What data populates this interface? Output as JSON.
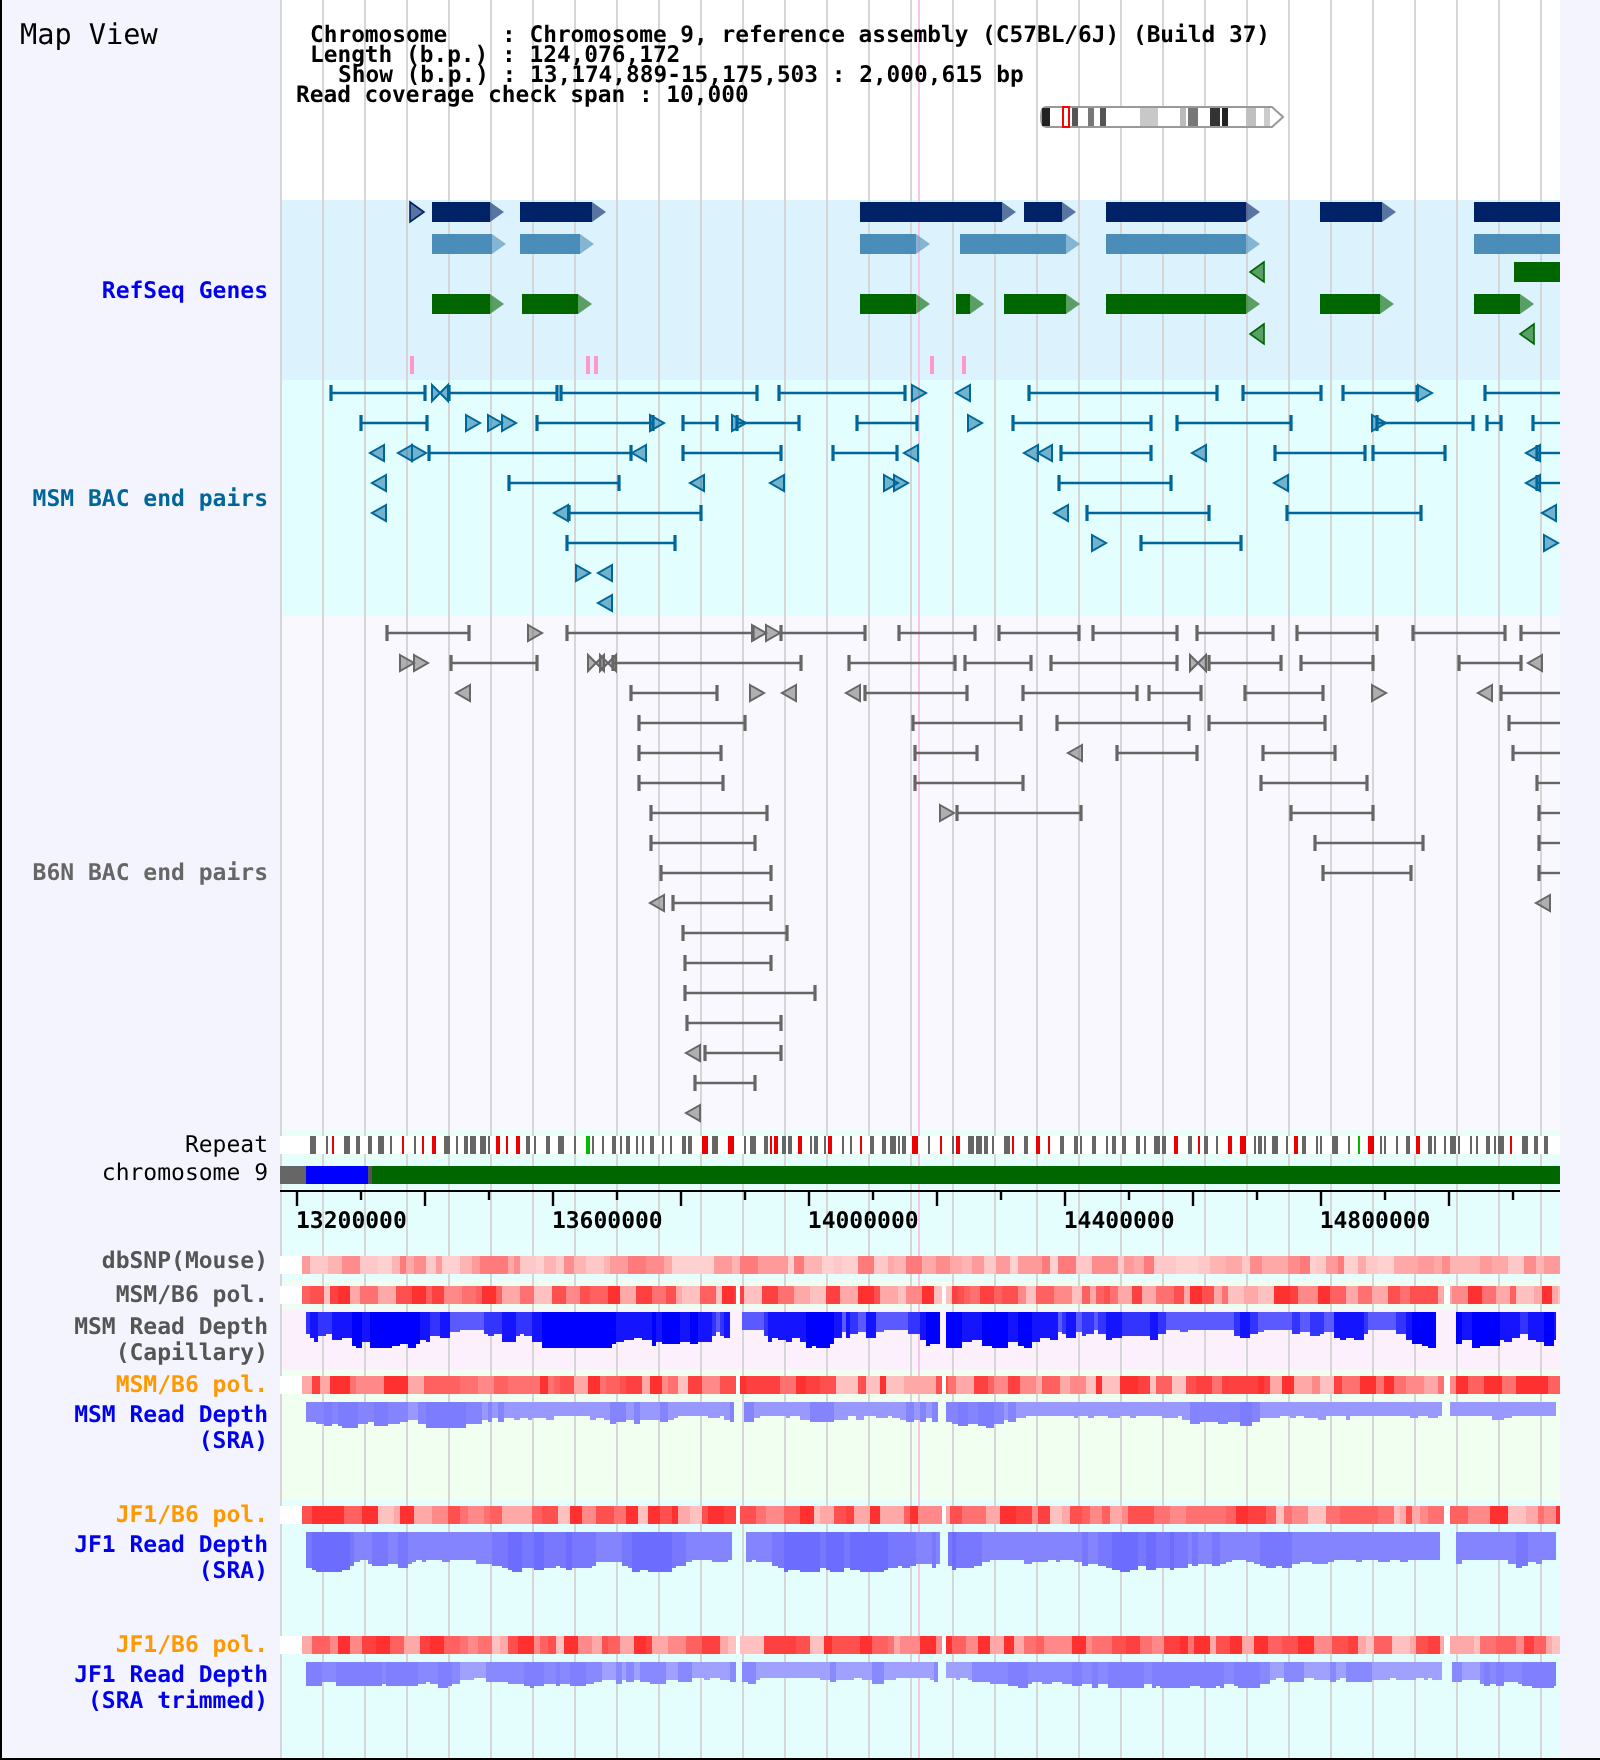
{
  "title": "Map View",
  "header": {
    "lines": [
      "Chromosome    : Chromosome 9, reference assembly (C57BL/6J) (Build 37)",
      "Length (b.p.) : 124,076,172",
      "Show (b.p.) : 13,174,889-15,175,503 : 2,000,615 bp",
      "Read coverage check span : 10,000"
    ]
  },
  "tracks": [
    {
      "label": "RefSeq Genes",
      "color": "#0000ee",
      "kind": "genes"
    },
    {
      "label": "MSM BAC end pairs",
      "color": "#006699",
      "kind": "pairs"
    },
    {
      "label": "B6N BAC end pairs",
      "color": "#666666",
      "kind": "pairs"
    },
    {
      "label": "Repeat",
      "color": "#000000",
      "kind": "repeat"
    },
    {
      "label": "chromosome 9",
      "color": "#000000",
      "kind": "contig"
    }
  ],
  "ruler": {
    "labels": [
      "13200000",
      "13600000",
      "14000000",
      "14400000",
      "14800000"
    ]
  },
  "lower_tracks": [
    {
      "label": "dbSNP(Mouse)",
      "color": "#555555",
      "kind": "heat"
    },
    {
      "label": "MSM/B6 pol.",
      "color": "#555555",
      "kind": "heat"
    },
    {
      "label": "MSM Read Depth (Capillary)",
      "color": "#555555",
      "kind": "depth"
    },
    {
      "label": "MSM/B6 pol.",
      "color": "#ff9900",
      "kind": "heat"
    },
    {
      "label": "MSM Read Depth (SRA)",
      "color": "#0000ee",
      "kind": "depth"
    },
    {
      "label": "JF1/B6 pol.",
      "color": "#ff9900",
      "kind": "heat"
    },
    {
      "label": "JF1 Read Depth (SRA)",
      "color": "#0000ee",
      "kind": "depth"
    },
    {
      "label": "JF1/B6 pol.",
      "color": "#ff9900",
      "kind": "heat"
    },
    {
      "label": "JF1 Read Depth (SRA trimmed)",
      "color": "#0000ee",
      "kind": "depth"
    }
  ]
}
